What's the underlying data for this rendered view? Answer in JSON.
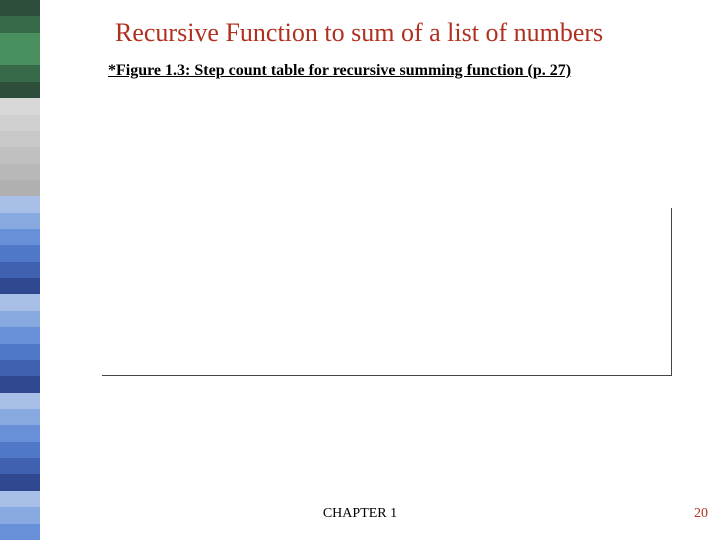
{
  "sidebar": {
    "colors": [
      "#2d4e3a",
      "#366a49",
      "#4a8f5e",
      "#4a8f5e",
      "#366a49",
      "#2d4e3a",
      "#d8d8d8",
      "#d0d0d0",
      "#c8c8c8",
      "#c0c0c0",
      "#b8b8b8",
      "#b0b0b0",
      "#a8c0e8",
      "#88a8e0",
      "#6890d8",
      "#5078c8",
      "#4060b0",
      "#304890",
      "#a8c0e8",
      "#88a8e0",
      "#6890d8",
      "#5078c8",
      "#4060b0",
      "#304890",
      "#a8c0e8",
      "#88a8e0",
      "#6890d8",
      "#5078c8",
      "#4060b0",
      "#304890",
      "#a8c0e8",
      "#88a8e0",
      "#6890d8"
    ]
  },
  "title": "Recursive Function to sum of a list of numbers",
  "caption": "*Figure 1.3: Step count table for recursive summing function (p. 27)",
  "footer": {
    "center": "CHAPTER 1",
    "page": "20"
  }
}
